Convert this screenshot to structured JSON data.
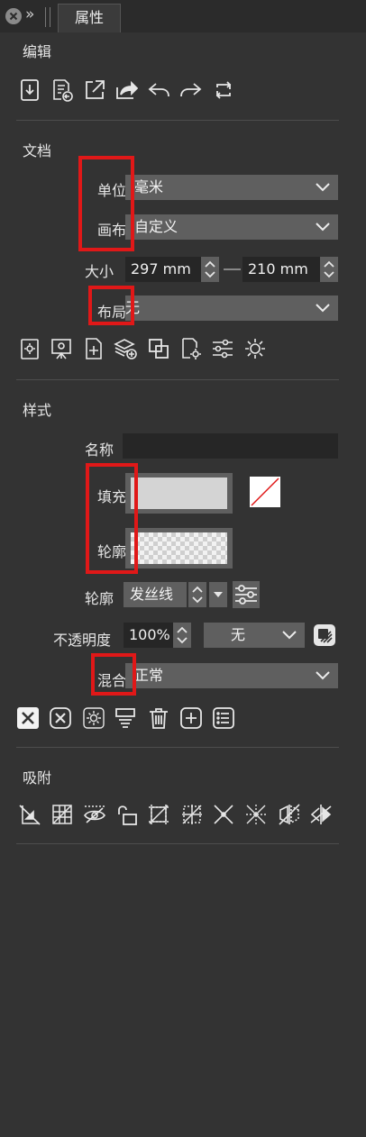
{
  "tab": {
    "title": "属性"
  },
  "sections": {
    "edit": "编辑",
    "document": "文档",
    "style": "样式",
    "snap": "吸附"
  },
  "document": {
    "units_label": "单位",
    "units_value": "毫米",
    "canvas_label": "画布",
    "canvas_value": "自定义",
    "size_label": "大小",
    "width": "297 mm",
    "height": "210 mm",
    "layout_label": "布局",
    "layout_value": "无"
  },
  "style": {
    "name_label": "名称",
    "name_value": "",
    "fill_label": "填充",
    "outline_label": "轮廓",
    "stroke_label": "轮廓",
    "stroke_value": "发丝线",
    "opacity_label": "不透明度",
    "opacity_value": "100%",
    "opacity_mode": "无",
    "blend_label": "混合",
    "blend_value": "正常"
  },
  "icons": {
    "edit": [
      "import-icon",
      "document-export-icon",
      "open-external-icon",
      "share-icon",
      "undo-icon",
      "redo-icon",
      "refresh-icon"
    ],
    "document": [
      "page-settings-icon",
      "presentation-settings-icon",
      "add-page-icon",
      "add-layer-icon",
      "duplicate-icon",
      "document-settings-icon",
      "adjust-sliders-icon",
      "gear-icon"
    ],
    "style": [
      "remove-style-icon",
      "clear-style-icon",
      "style-settings-icon",
      "apply-style-icon",
      "delete-icon",
      "add-style-icon",
      "style-list-icon"
    ],
    "snap": [
      "snap-page-icon",
      "snap-grid-icon",
      "snap-visible-icon",
      "snap-unlock-icon",
      "snap-bounds-icon",
      "snap-center-icon",
      "snap-intersection-icon",
      "snap-guide-icon",
      "snap-mirror-icon",
      "snap-flip-icon"
    ]
  },
  "colors": {
    "panel": "#333333",
    "field": "#5f5f5f",
    "highlight": "#e01818"
  }
}
